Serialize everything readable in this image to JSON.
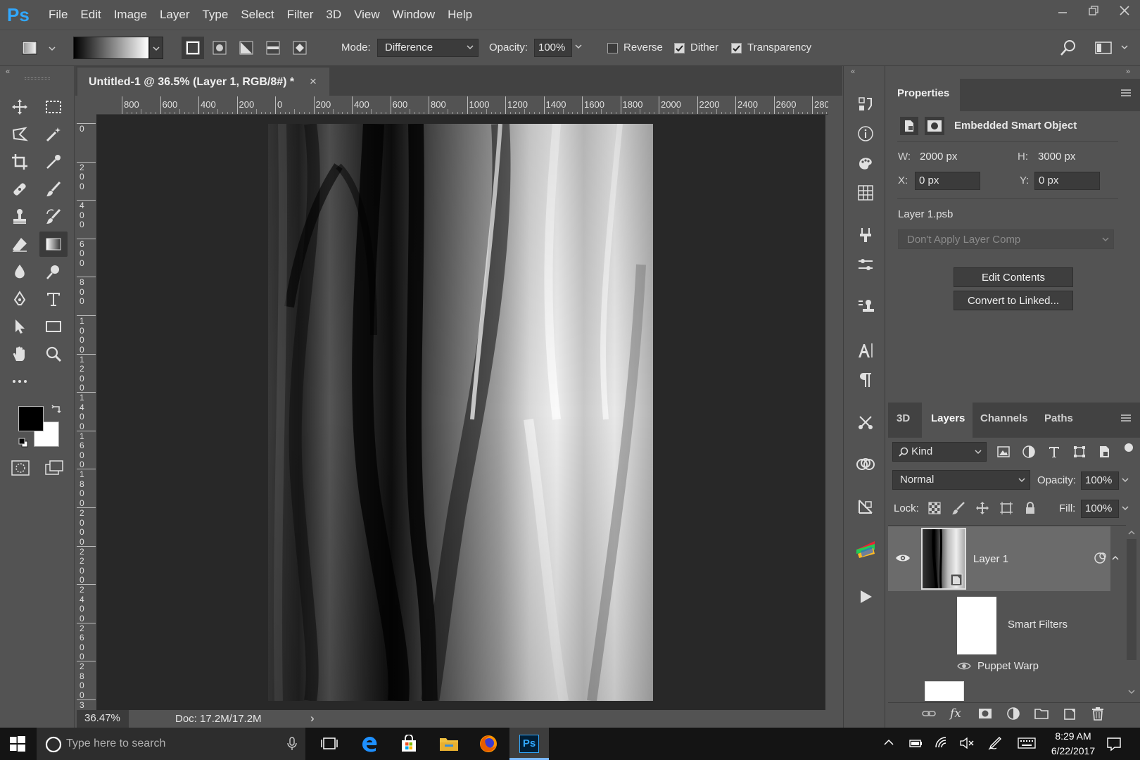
{
  "app": {
    "logo": "Ps"
  },
  "menu": [
    "File",
    "Edit",
    "Image",
    "Layer",
    "Type",
    "Select",
    "Filter",
    "3D",
    "View",
    "Window",
    "Help"
  ],
  "options": {
    "mode_label": "Mode:",
    "mode_value": "Difference",
    "opacity_label": "Opacity:",
    "opacity_value": "100%",
    "reverse_label": "Reverse",
    "reverse_checked": false,
    "dither_label": "Dither",
    "dither_checked": true,
    "transparency_label": "Transparency",
    "transparency_checked": true
  },
  "document": {
    "tab_title": "Untitled-1 @ 36.5% (Layer 1, RGB/8#) *",
    "close_glyph": "×",
    "zoom": "36.47%",
    "doc_size": "Doc: 17.2M/17.2M",
    "status_arrow": "›"
  },
  "rulers": {
    "h_ticks": [
      "800",
      "600",
      "400",
      "200",
      "0",
      "200",
      "400",
      "600",
      "800",
      "1000",
      "1200",
      "1400",
      "1600",
      "1800",
      "2000",
      "2200",
      "2400",
      "2600",
      "280"
    ],
    "v_ticks": [
      "0",
      "2\n0\n0",
      "4\n0\n0",
      "6\n0\n0",
      "8\n0\n0",
      "1\n0\n0\n0",
      "1\n2\n0\n0",
      "1\n4\n0\n0",
      "1\n6\n0\n0",
      "1\n8\n0\n0",
      "2\n0\n0\n0",
      "2\n2\n0\n0",
      "2\n4\n0\n0",
      "2\n6\n0\n0",
      "2\n8\n0\n0",
      "3"
    ]
  },
  "properties": {
    "tab": "Properties",
    "type": "Embedded Smart Object",
    "w_label": "W:",
    "w_value": "2000 px",
    "h_label": "H:",
    "h_value": "3000 px",
    "x_label": "X:",
    "x_value": "0 px",
    "y_label": "Y:",
    "y_value": "0 px",
    "file": "Layer 1.psb",
    "layer_comp": "Don't Apply Layer Comp",
    "edit_contents": "Edit Contents",
    "convert_linked": "Convert to Linked..."
  },
  "layers_panel": {
    "tabs": [
      "3D",
      "Layers",
      "Channels",
      "Paths"
    ],
    "active_tab": "Layers",
    "filter_kind": "Kind",
    "blend_mode": "Normal",
    "opacity_label": "Opacity:",
    "opacity_value": "100%",
    "lock_label": "Lock:",
    "fill_label": "Fill:",
    "fill_value": "100%",
    "layers": [
      {
        "name": "Layer 1",
        "visible": true
      },
      {
        "name": "Smart Filters"
      },
      {
        "name": "Puppet Warp",
        "visible": true
      }
    ]
  },
  "taskbar": {
    "search_placeholder": "Type here to search",
    "time": "8:29 AM",
    "date": "6/22/2017"
  },
  "colors": {
    "accent": "#31a8ff",
    "foreground_swatch": "#000000",
    "background_swatch": "#ffffff"
  }
}
